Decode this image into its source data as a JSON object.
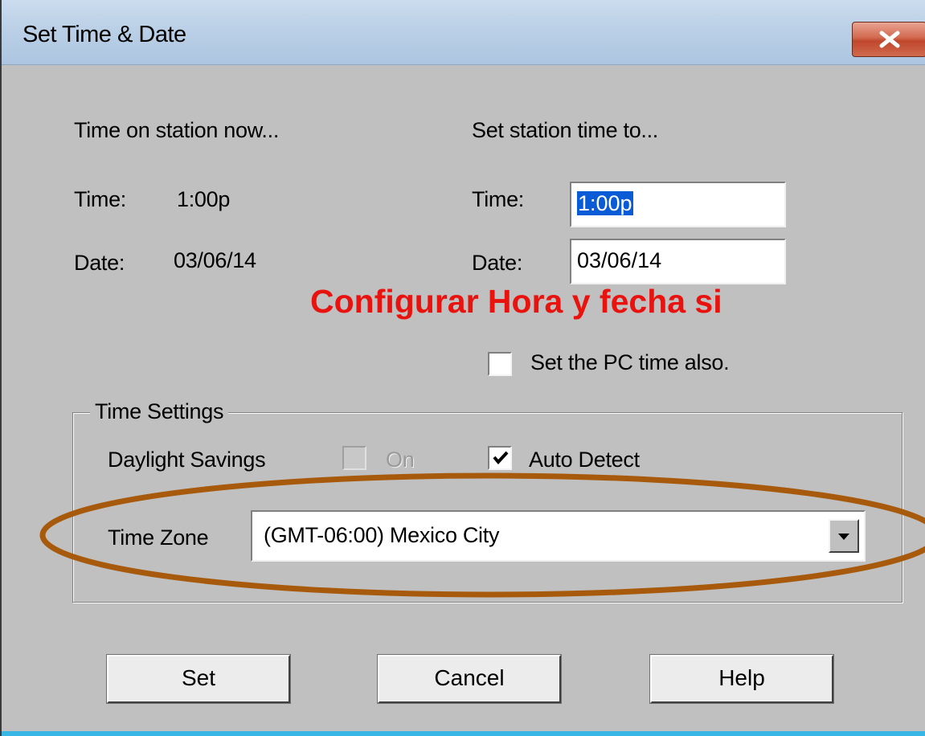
{
  "window": {
    "title": "Set Time & Date"
  },
  "current": {
    "heading": "Time on station now...",
    "time_label": "Time:",
    "time_value": "1:00p",
    "date_label": "Date:",
    "date_value": "03/06/14"
  },
  "set_to": {
    "heading": "Set station time to...",
    "time_label": "Time:",
    "time_value": "1:00p",
    "date_label": "Date:",
    "date_value": "03/06/14",
    "pc_time_label": "Set the PC time also.",
    "pc_time_checked": false
  },
  "annotation": {
    "text": "Configurar Hora y fecha si",
    "color": "#e8130f",
    "ellipse_color": "#a85a0c"
  },
  "time_settings": {
    "group_title": "Time Settings",
    "dst_label": "Daylight Savings",
    "dst_on_label": "On",
    "dst_on_checked": false,
    "auto_detect_label": "Auto Detect",
    "auto_detect_checked": true,
    "timezone_label": "Time Zone",
    "timezone_value": "(GMT-06:00) Mexico City"
  },
  "buttons": {
    "set": "Set",
    "cancel": "Cancel",
    "help": "Help"
  }
}
